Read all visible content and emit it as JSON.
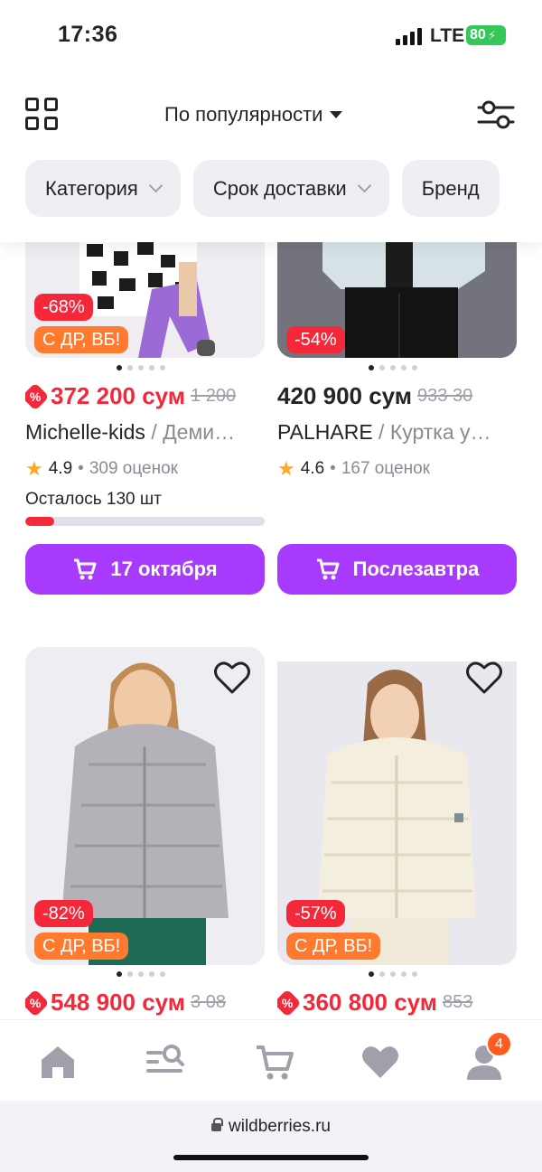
{
  "status_bar": {
    "time": "17:36",
    "network": "LTE",
    "battery": "80"
  },
  "header": {
    "sort_label": "По популярности",
    "filters": [
      "Категория",
      "Срок доставки",
      "Бренд"
    ]
  },
  "products": [
    {
      "discount": "-68%",
      "promo": "С ДР, ВБ!",
      "price": "372 200 сум",
      "old_price": "1 200",
      "brand": "Michelle-kids",
      "title": " / Деми…",
      "rating": "4.9",
      "reviews": "309 оценок",
      "stock_label": "Осталось 130 шт",
      "stock_fraction": 0.12,
      "delivery": "17 октября"
    },
    {
      "discount": "-54%",
      "price": "420 900 сум",
      "old_price": "933 30",
      "brand": "PALHARE",
      "title": " / Куртка у…",
      "rating": "4.6",
      "reviews": "167 оценок",
      "delivery": "Послезавтра"
    },
    {
      "discount": "-82%",
      "promo": "С ДР, ВБ!",
      "price": "548 900 сум",
      "old_price": "3 08"
    },
    {
      "discount": "-57%",
      "promo": "С ДР, ВБ!",
      "price": "360 800 сум",
      "old_price": "853"
    }
  ],
  "tabbar": {
    "profile_badge": "4"
  },
  "browser": {
    "url": "wildberries.ru"
  },
  "colors": {
    "accent": "#a73afd",
    "discount": "#f5283a",
    "promo": "#ff7a2e"
  }
}
